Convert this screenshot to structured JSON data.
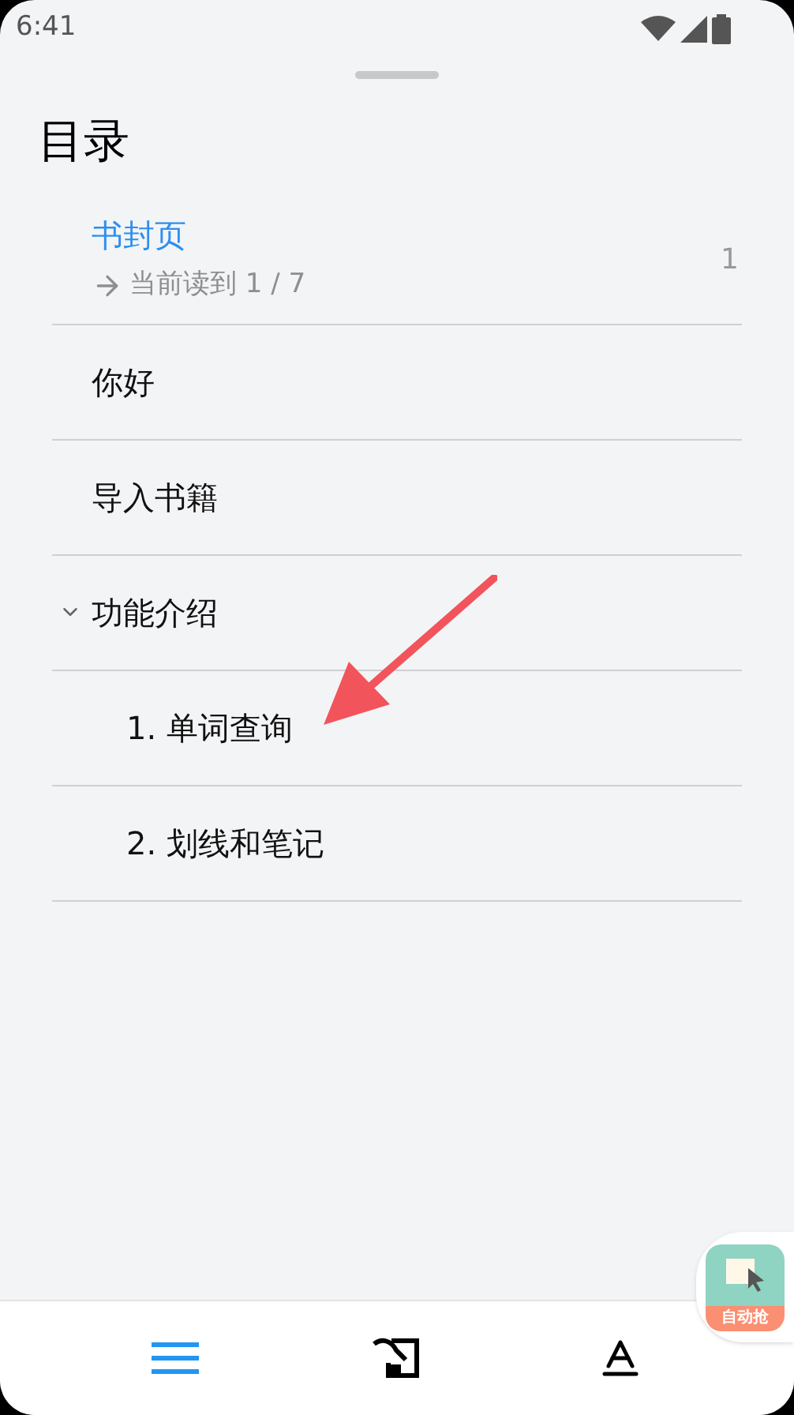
{
  "status_bar": {
    "time": "6:41"
  },
  "title": "目录",
  "toc": [
    {
      "label": "书封页",
      "selected": true,
      "progress": "当前读到 1 / 7",
      "page": "1"
    },
    {
      "label": "你好",
      "selected": false
    },
    {
      "label": "导入书籍",
      "selected": false
    },
    {
      "label": "功能介绍",
      "selected": false,
      "expanded": true,
      "children": [
        {
          "label": "1. 单词查询",
          "selected": false
        },
        {
          "label": "2. 划线和笔记",
          "selected": false
        }
      ]
    }
  ],
  "bottom_nav": [
    {
      "kind": "contents",
      "selected": true
    },
    {
      "kind": "notes",
      "selected": false
    },
    {
      "kind": "font",
      "selected": false
    }
  ],
  "floating_widget": {
    "label": "自动抢"
  }
}
